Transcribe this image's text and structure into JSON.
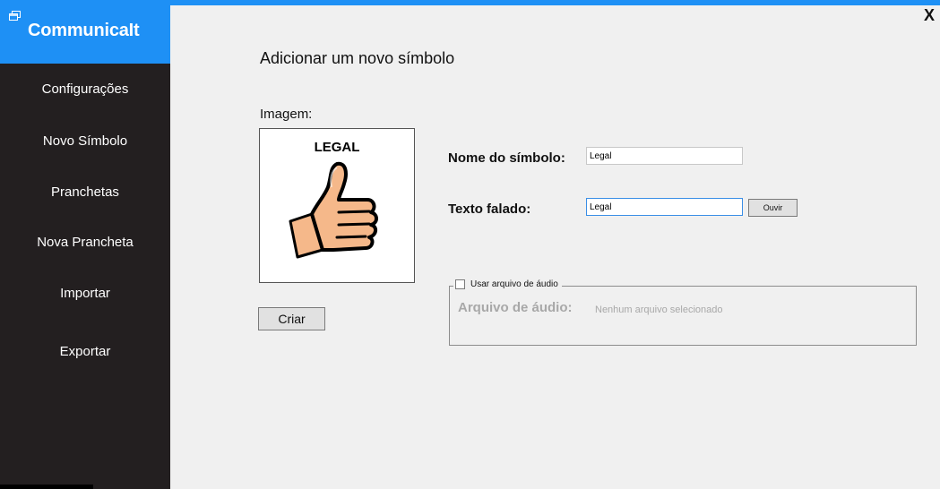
{
  "app": {
    "title": "CommunicaIt"
  },
  "sidebar": {
    "items": [
      {
        "label": "Configurações"
      },
      {
        "label": "Novo Símbolo"
      },
      {
        "label": "Pranchetas"
      },
      {
        "label": "Nova Prancheta"
      },
      {
        "label": "Importar"
      },
      {
        "label": "Exportar"
      }
    ]
  },
  "window": {
    "close_label": "X"
  },
  "form": {
    "title": "Adicionar um novo símbolo",
    "image_label": "Imagem:",
    "image_caption": "LEGAL",
    "image_icon": "thumbs-up-icon",
    "name_label": "Nome do símbolo:",
    "name_value": "Legal",
    "speech_label": "Texto falado:",
    "speech_value": "Legal",
    "listen_button": "Ouvir",
    "create_button": "Criar",
    "audio_group_label": "Usar arquivo de áudio",
    "audio_checked": false,
    "audio_file_label": "Arquivo de áudio:",
    "audio_file_value": "Nenhum arquivo selecionado"
  },
  "colors": {
    "accent": "#1e90f5",
    "sidebar": "#231f20",
    "background": "#f0f0f0",
    "disabled_text": "#a8a8a8"
  }
}
